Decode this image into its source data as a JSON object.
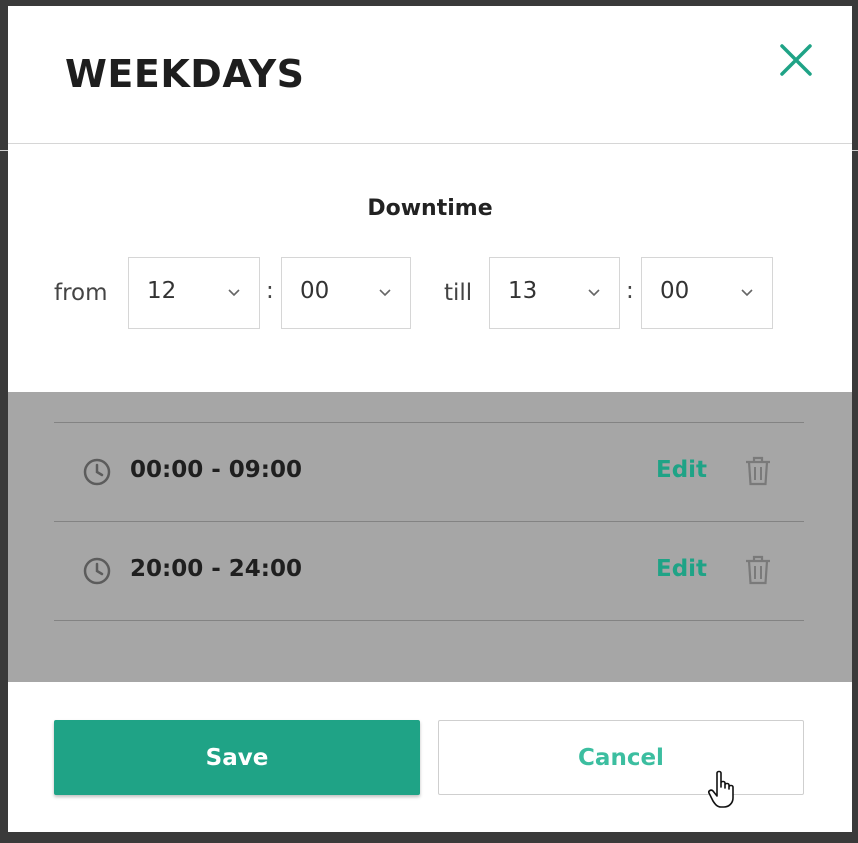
{
  "dialog": {
    "title": "WEEKDAYS"
  },
  "downtime": {
    "label": "Downtime",
    "from_label": "from",
    "till_label": "till",
    "separator": ":",
    "from_hour": "12",
    "from_minute": "00",
    "till_hour": "13",
    "till_minute": "00"
  },
  "intervals": [
    {
      "range": "00:00 - 09:00",
      "edit_label": "Edit"
    },
    {
      "range": "20:00 - 24:00",
      "edit_label": "Edit"
    }
  ],
  "footer": {
    "save_label": "Save",
    "cancel_label": "Cancel"
  },
  "colors": {
    "accent": "#1fa386",
    "accent_light": "#3cbea0",
    "overlay": "#a6a6a6"
  }
}
